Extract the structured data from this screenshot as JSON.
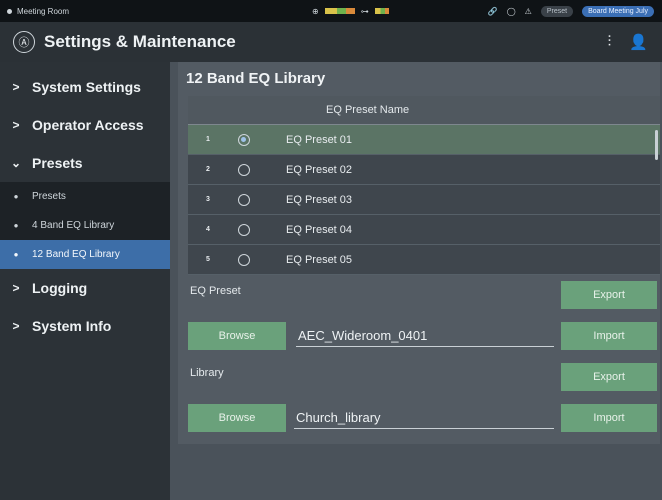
{
  "topbar": {
    "room": "Meeting Room",
    "preset_label": "Preset",
    "scene_label": "Board Meeting July"
  },
  "header": {
    "title": "Settings & Maintenance"
  },
  "sidebar": {
    "items": [
      {
        "label": "System Settings"
      },
      {
        "label": "Operator Access"
      },
      {
        "label": "Presets"
      },
      {
        "label": "Logging"
      },
      {
        "label": "System Info"
      }
    ],
    "subitems": [
      {
        "label": "Presets"
      },
      {
        "label": "4 Band EQ Library"
      },
      {
        "label": "12 Band EQ Library"
      }
    ]
  },
  "main": {
    "title": "12 Band EQ Library",
    "table": {
      "column_header": "EQ Preset Name",
      "rows": [
        {
          "num": "1",
          "name": "EQ Preset 01"
        },
        {
          "num": "2",
          "name": "EQ Preset 02"
        },
        {
          "num": "3",
          "name": "EQ Preset 03"
        },
        {
          "num": "4",
          "name": "EQ Preset 04"
        },
        {
          "num": "5",
          "name": "EQ Preset 05"
        }
      ]
    },
    "eq_preset": {
      "label": "EQ Preset",
      "export": "Export",
      "browse": "Browse",
      "file": "AEC_Wideroom_0401",
      "import": "Import"
    },
    "library": {
      "label": "Library",
      "export": "Export",
      "browse": "Browse",
      "file": "Church_library",
      "import": "Import"
    }
  }
}
